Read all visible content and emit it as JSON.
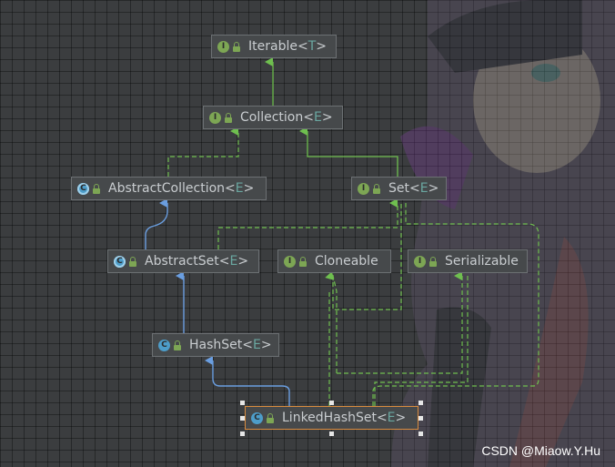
{
  "colors": {
    "interface_badge": "#7da654",
    "class_badge": "#4d9dc9",
    "extends_edge": "#6a9ee0",
    "implements_edge": "#6fbf4f",
    "selected_border": "#d98c3f"
  },
  "nodes": {
    "iterable": {
      "name": "Iterable",
      "type_param": "T",
      "kind": "interface",
      "badge": "I"
    },
    "collection": {
      "name": "Collection",
      "type_param": "E",
      "kind": "interface",
      "badge": "I"
    },
    "abstract_collection": {
      "name": "AbstractCollection",
      "type_param": "E",
      "kind": "abstract-class",
      "badge": "C"
    },
    "set": {
      "name": "Set",
      "type_param": "E",
      "kind": "interface",
      "badge": "I"
    },
    "abstract_set": {
      "name": "AbstractSet",
      "type_param": "E",
      "kind": "abstract-class",
      "badge": "C"
    },
    "cloneable": {
      "name": "Cloneable",
      "type_param": "",
      "kind": "interface",
      "badge": "I"
    },
    "serializable": {
      "name": "Serializable",
      "type_param": "",
      "kind": "interface",
      "badge": "I"
    },
    "hash_set": {
      "name": "HashSet",
      "type_param": "E",
      "kind": "class",
      "badge": "C"
    },
    "linked_hash_set": {
      "name": "LinkedHashSet",
      "type_param": "E",
      "kind": "class",
      "badge": "C",
      "selected": true
    }
  },
  "edges": [
    {
      "from": "collection",
      "to": "iterable",
      "relation": "extends-interface"
    },
    {
      "from": "abstract_collection",
      "to": "collection",
      "relation": "implements"
    },
    {
      "from": "set",
      "to": "collection",
      "relation": "extends-interface"
    },
    {
      "from": "abstract_set",
      "to": "abstract_collection",
      "relation": "extends"
    },
    {
      "from": "hash_set",
      "to": "abstract_set",
      "relation": "extends"
    },
    {
      "from": "hash_set",
      "to": "set",
      "relation": "implements"
    },
    {
      "from": "hash_set",
      "to": "cloneable",
      "relation": "implements"
    },
    {
      "from": "hash_set",
      "to": "serializable",
      "relation": "implements"
    },
    {
      "from": "linked_hash_set",
      "to": "hash_set",
      "relation": "extends"
    },
    {
      "from": "linked_hash_set",
      "to": "set",
      "relation": "implements"
    },
    {
      "from": "linked_hash_set",
      "to": "cloneable",
      "relation": "implements"
    },
    {
      "from": "linked_hash_set",
      "to": "serializable",
      "relation": "implements"
    },
    {
      "from": "abstract_set",
      "to": "set",
      "relation": "implements"
    }
  ],
  "watermark": "CSDN @Miaow.Y.Hu"
}
